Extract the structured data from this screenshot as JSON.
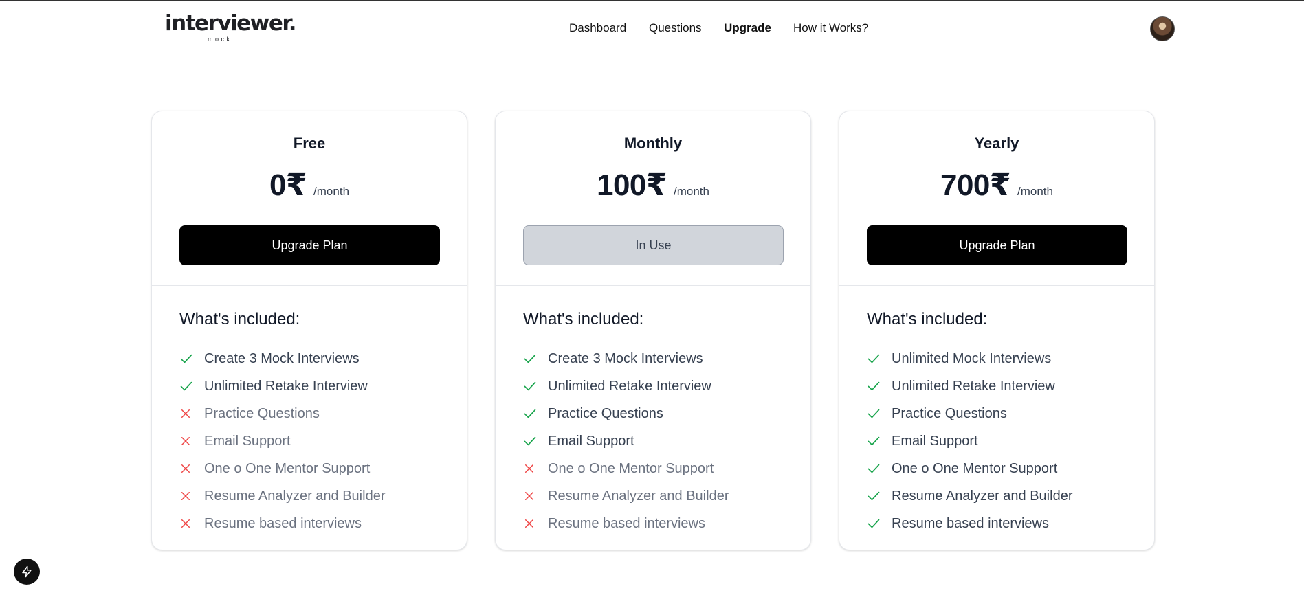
{
  "header": {
    "logo_text": "interviewer.",
    "logo_sub": "mock",
    "nav": [
      {
        "label": "Dashboard"
      },
      {
        "label": "Questions"
      },
      {
        "label": "Upgrade"
      },
      {
        "label": "How it Works?"
      }
    ],
    "active_nav": "Upgrade",
    "avatar_icon": "user-avatar"
  },
  "included_heading": "What's included:",
  "plans": [
    {
      "name": "Free",
      "price": "0₹",
      "period": "/month",
      "button": "Upgrade Plan",
      "features": [
        {
          "label": "Create 3 Mock Interviews",
          "included": true
        },
        {
          "label": "Unlimited Retake Interview",
          "included": true
        },
        {
          "label": "Practice Questions",
          "included": false
        },
        {
          "label": "Email Support",
          "included": false
        },
        {
          "label": "One o One Mentor Support",
          "included": false
        },
        {
          "label": "Resume Analyzer and Builder",
          "included": false
        },
        {
          "label": "Resume based interviews",
          "included": false
        }
      ]
    },
    {
      "name": "Monthly",
      "price": "100₹",
      "period": "/month",
      "button": "In Use",
      "features": [
        {
          "label": "Create 3 Mock Interviews",
          "included": true
        },
        {
          "label": "Unlimited Retake Interview",
          "included": true
        },
        {
          "label": "Practice Questions",
          "included": true
        },
        {
          "label": "Email Support",
          "included": true
        },
        {
          "label": "One o One Mentor Support",
          "included": false
        },
        {
          "label": "Resume Analyzer and Builder",
          "included": false
        },
        {
          "label": "Resume based interviews",
          "included": false
        }
      ]
    },
    {
      "name": "Yearly",
      "price": "700₹",
      "period": "/month",
      "button": "Upgrade Plan",
      "features": [
        {
          "label": "Unlimited Mock Interviews",
          "included": true
        },
        {
          "label": "Unlimited Retake Interview",
          "included": true
        },
        {
          "label": "Practice Questions",
          "included": true
        },
        {
          "label": "Email Support",
          "included": true
        },
        {
          "label": "One o One Mentor Support",
          "included": true
        },
        {
          "label": "Resume Analyzer and Builder",
          "included": true
        },
        {
          "label": "Resume based interviews",
          "included": true
        }
      ]
    }
  ],
  "colors": {
    "check": "#16a34a",
    "cross": "#ef4444",
    "primary_button": "#000000",
    "in_use_button": "#d1d5db"
  },
  "floating_button_icon": "lightning-bolt-icon"
}
